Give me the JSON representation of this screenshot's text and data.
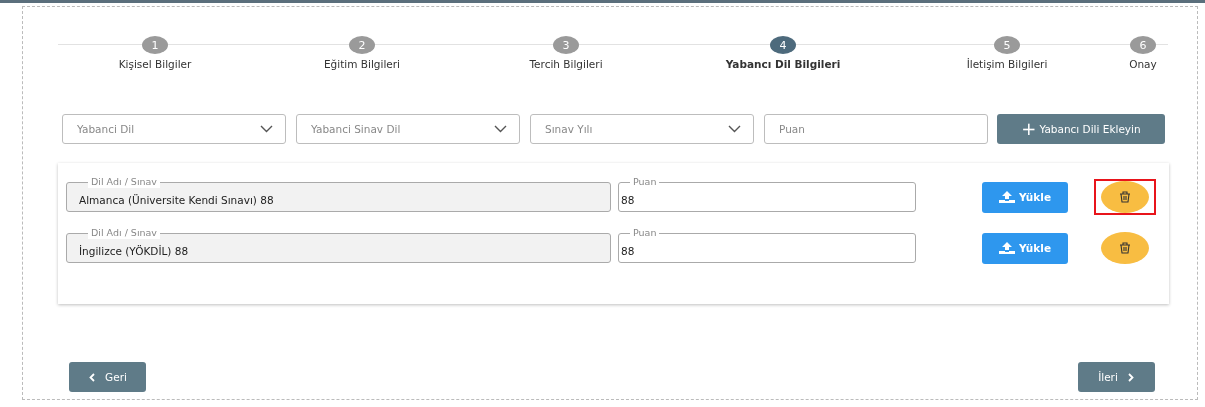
{
  "steps": [
    {
      "number": "1",
      "label": "Kişisel Bilgiler",
      "selected": false
    },
    {
      "number": "2",
      "label": "Eğitim Bilgileri",
      "selected": false
    },
    {
      "number": "3",
      "label": "Tercih Bilgileri",
      "selected": false
    },
    {
      "number": "4",
      "label": "Yabancı Dil Bilgileri",
      "selected": true
    },
    {
      "number": "5",
      "label": "İletişim Bilgileri",
      "selected": false
    },
    {
      "number": "6",
      "label": "Onay",
      "selected": false
    }
  ],
  "filters": [
    {
      "kind": "select",
      "placeholder": "Yabanci Dil"
    },
    {
      "kind": "select",
      "placeholder": "Yabanci Sinav Dil"
    },
    {
      "kind": "select",
      "placeholder": "Sınav Yılı"
    },
    {
      "kind": "input",
      "placeholder": "Puan"
    }
  ],
  "add_button": {
    "icon": "+",
    "label": "Yabancı Dili Ekleyin"
  },
  "languages": [
    {
      "name_label": "Dil Adı / Sınav",
      "name": "Almanca (Üniversite Kendi Sınavı) 88",
      "score_label": "Puan",
      "score": "88",
      "upload": "Yükle",
      "highlighted": true
    },
    {
      "name_label": "Dil Adı / Sınav",
      "name": "İngilizce (YÖKDİL) 88",
      "score_label": "Puan",
      "score": "88",
      "upload": "Yükle",
      "highlighted": false
    }
  ],
  "back_button": {
    "label": "Geri"
  },
  "next_button": {
    "label": "İleri"
  }
}
